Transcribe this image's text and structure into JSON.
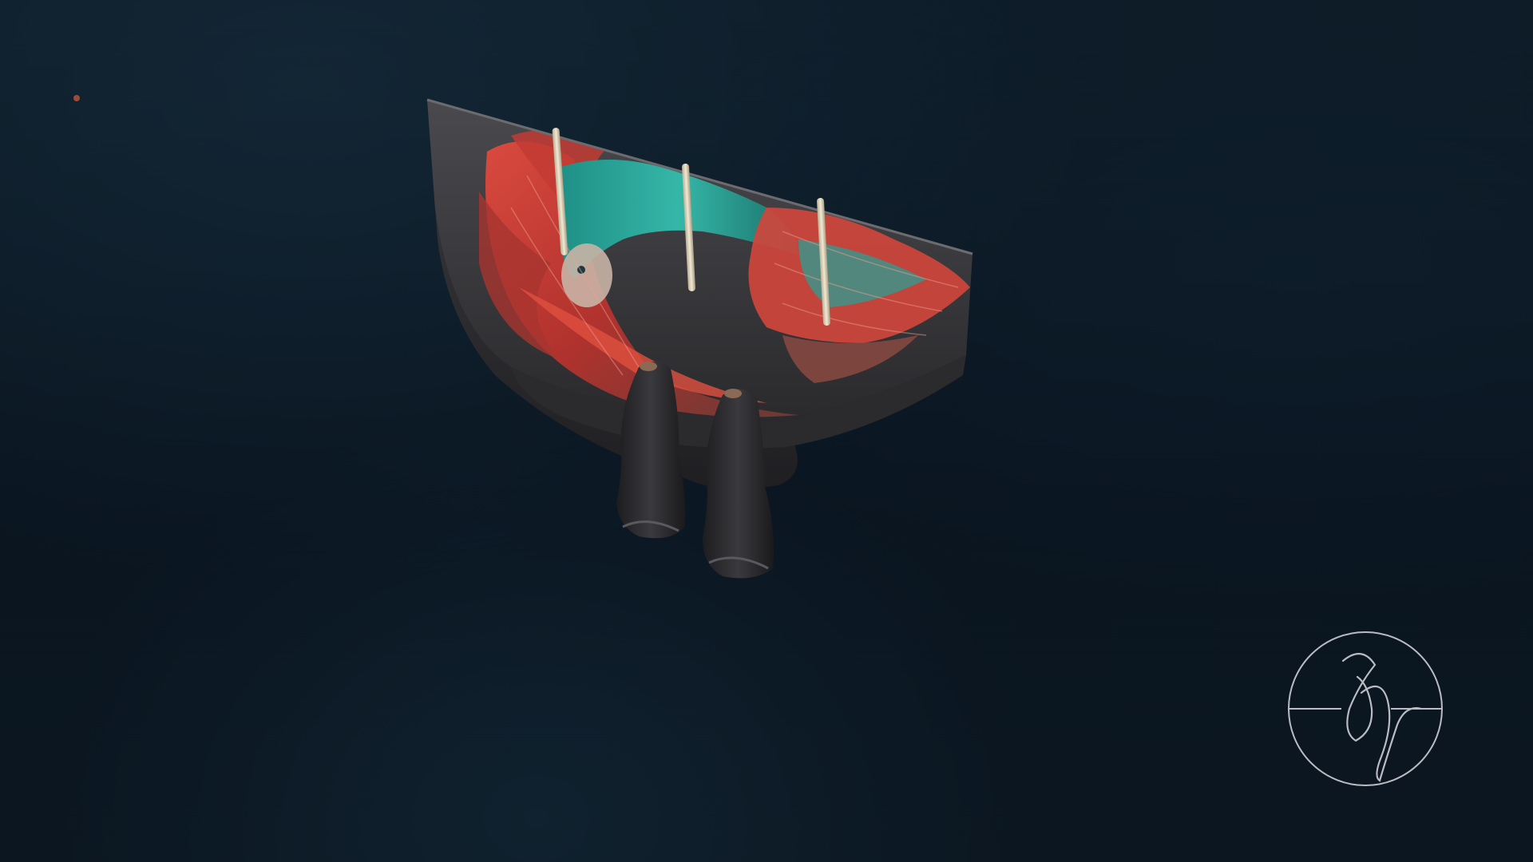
{
  "scene": {
    "subject": "tailpiece-render",
    "background_color": "#0b1622",
    "accent_colors": {
      "fin_red": "#d9453c",
      "scales_teal": "#2aa79a",
      "wood_dark": "#3a3a3d",
      "string_ivory": "#e8dfc8"
    },
    "icons": {
      "logo": "signature-monogram-icon"
    }
  }
}
